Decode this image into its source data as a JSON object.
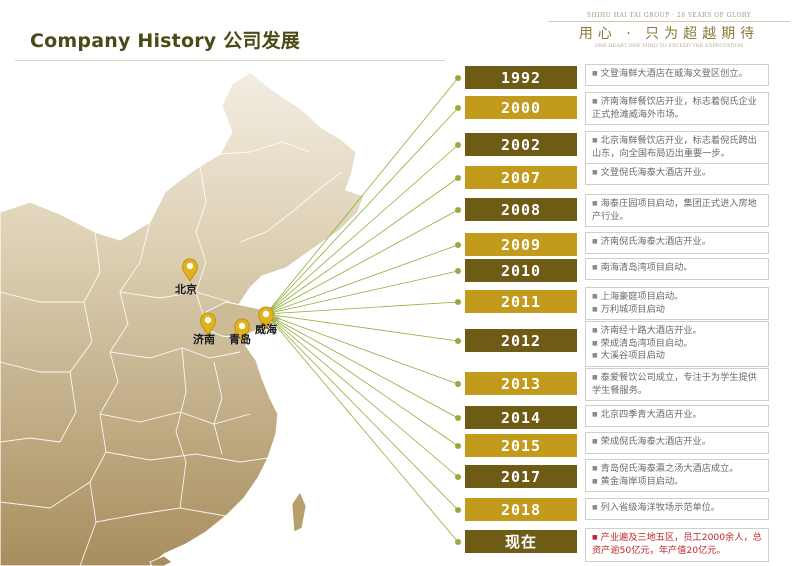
{
  "header": {
    "title": "Company History 公司发展",
    "brand_en": "SHIHU HAI TAI GROUP · 28 YEARS OF GLORY",
    "brand_cn": "用心 · 只为超越期待",
    "brand_sub": "ONE HEART ONE MIND TO EXCEED THE EXPECTATION"
  },
  "map": {
    "cities": [
      "北京",
      "济南",
      "青岛",
      "威海"
    ],
    "colors": {
      "land": "#c9b48a",
      "land_light": "#efe7d6",
      "border": "#ffffff",
      "pin": "#e0b21c",
      "line": "#8fae3a"
    }
  },
  "timeline": [
    {
      "year": "1992",
      "style": "dark",
      "lines": [
        "文登海鲜大酒店在威海文登区创立。"
      ]
    },
    {
      "year": "2000",
      "style": "gold",
      "lines": [
        "济南海鲜餐饮店开业，标志着倪氏企业正式抢滩威海外市场。"
      ]
    },
    {
      "year": "2002",
      "style": "dark",
      "lines": [
        "北京海鲜餐饮店开业，标志着倪氏跨出山东，向全国布局迈出重要一步。"
      ]
    },
    {
      "year": "2007",
      "style": "gold",
      "lines": [
        "文登倪氏海泰大酒店开业。"
      ]
    },
    {
      "year": "2008",
      "style": "dark",
      "lines": [
        "海泰庄园项目启动，集团正式进入房地产行业。"
      ]
    },
    {
      "year": "2009",
      "style": "gold",
      "lines": [
        "济南倪氏海泰大酒店开业。"
      ]
    },
    {
      "year": "2010",
      "style": "dark",
      "lines": [
        "南海清岛湾项目启动。"
      ]
    },
    {
      "year": "2011",
      "style": "gold",
      "lines": [
        "上海豪庭项目启动。",
        "万利城项目启动"
      ]
    },
    {
      "year": "2012",
      "style": "dark",
      "lines": [
        "济南经十路大酒店开业。",
        "荣成清岛湾项目启动。",
        "大溪谷项目启动"
      ]
    },
    {
      "year": "2013",
      "style": "gold",
      "lines": [
        "泰爱餐饮公司成立，专注于为学生提供学生餐服务。"
      ]
    },
    {
      "year": "2014",
      "style": "dark",
      "lines": [
        "北京四季青大酒店开业。"
      ]
    },
    {
      "year": "2015",
      "style": "gold",
      "lines": [
        "荣成倪氏海泰大酒店开业。"
      ]
    },
    {
      "year": "2017",
      "style": "dark",
      "lines": [
        "青岛倪氏海泰瀛之汤大酒店成立。",
        "黄金海岸项目启动。"
      ]
    },
    {
      "year": "2018",
      "style": "gold",
      "lines": [
        "列入省级海洋牧场示范单位。"
      ]
    },
    {
      "year": "现在",
      "style": "dark",
      "lines": [
        "产业遍及三地五区，员工2000余人，总资产逾50亿元，年产值20亿元。"
      ],
      "highlight": true
    }
  ]
}
